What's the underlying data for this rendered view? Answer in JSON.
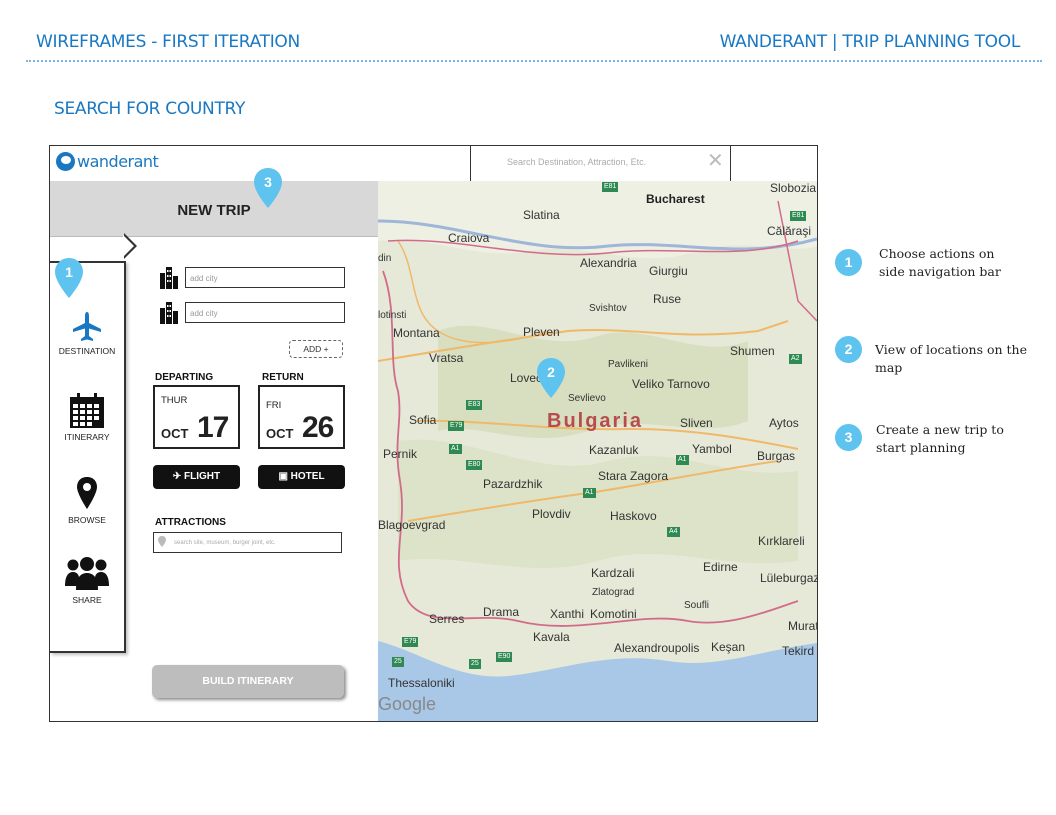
{
  "header": {
    "left_title": "WIREFRAMES - FIRST ITERATION",
    "right_title": "WANDERANT | TRIP PLANNING TOOL"
  },
  "section_title": "SEARCH FOR COUNTRY",
  "app": {
    "logo_text": "wanderant",
    "search": {
      "placeholder": "Search Destination, Attraction, Etc.",
      "clear_icon": "close-icon"
    },
    "panel": {
      "title": "NEW TRIP",
      "nav": [
        {
          "label": "DESTINATION",
          "icon": "airplane-icon"
        },
        {
          "label": "ITINERARY",
          "icon": "calendar-icon"
        },
        {
          "label": "BROWSE",
          "icon": "map-pin-icon"
        },
        {
          "label": "SHARE",
          "icon": "people-icon"
        }
      ],
      "city_fields": [
        {
          "placeholder": "add city"
        },
        {
          "placeholder": "add city"
        }
      ],
      "add_button": "ADD +",
      "departing": {
        "label": "DEPARTING",
        "dow": "THUR",
        "month": "OCT",
        "day": "17"
      },
      "return": {
        "label": "RETURN",
        "dow": "FRI",
        "month": "OCT",
        "day": "26"
      },
      "flight_button": "FLIGHT",
      "hotel_button": "HOTEL",
      "attractions": {
        "label": "ATTRACTIONS",
        "placeholder": "search site, museum, burger joint, etc."
      },
      "build_button": "BUILD ITINERARY"
    },
    "map": {
      "country_label": "Bulgaria",
      "places": [
        "Bucharest",
        "Slatina",
        "Craiova",
        "Alexandria",
        "Giurgiu",
        "Ruse",
        "Svishtov",
        "Slobozia",
        "Călăraşi",
        "Montana",
        "Vratsa",
        "Pleven",
        "Pavlikeni",
        "Veliko Tarnovo",
        "Shumen",
        "Lovech",
        "Sevlievo",
        "Sofia",
        "Pernik",
        "Kazanluk",
        "Sliven",
        "Yambol",
        "Burgas",
        "Aytos",
        "Stara Zagora",
        "Pazardzhik",
        "Plovdiv",
        "Haskovo",
        "Blagoevgrad",
        "Kardzali",
        "Zlatograd",
        "Edirne",
        "Kırklareli",
        "Lüleburgaz",
        "Serres",
        "Drama",
        "Xanthi",
        "Komotini",
        "Soufli",
        "Kavala",
        "Alexandroupolis",
        "Keşan",
        "Thessaloniki",
        "Tekird",
        "Murat",
        "din",
        "lotinsti",
        "Google"
      ],
      "roads": [
        "E81",
        "E81",
        "E83",
        "E79",
        "A1",
        "E80",
        "A1",
        "A1",
        "A4",
        "E79",
        "E90",
        "25",
        "25",
        "A2"
      ],
      "markers": [
        "2"
      ]
    }
  },
  "callouts": [
    {
      "number": "1",
      "text_line1": "Choose actions on",
      "text_line2": "side navigation bar"
    },
    {
      "number": "2",
      "text_line1": "View of locations on the map",
      "text_line2": ""
    },
    {
      "number": "3",
      "text_line1": "Create a new trip to",
      "text_line2": "start planning"
    }
  ],
  "colors": {
    "accent_blue": "#1a78c2",
    "callout_blue": "#5ec3ef",
    "panel_header_gray": "#d8d8d8",
    "build_button_gray": "#bdbdbd",
    "map_country_label": "#b84c4c"
  }
}
